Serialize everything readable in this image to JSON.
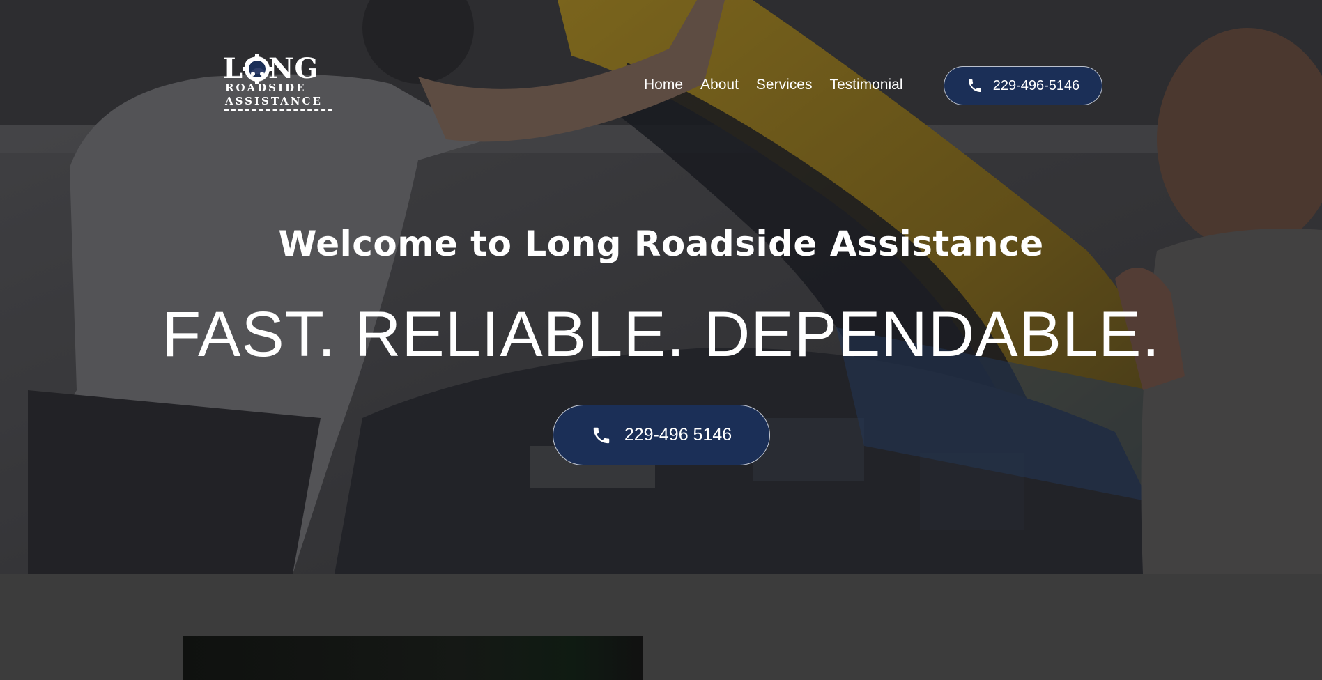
{
  "logo": {
    "word": "LONG",
    "line1": "ROADSIDE",
    "line2": "ASSISTANCE"
  },
  "nav": {
    "items": [
      {
        "label": "Home"
      },
      {
        "label": "About"
      },
      {
        "label": "Services"
      },
      {
        "label": "Testimonial"
      }
    ]
  },
  "header": {
    "phone_label": "229-496-5146"
  },
  "hero": {
    "welcome": "Welcome to Long Roadside Assistance",
    "tagline": "FAST. RELIABLE. DEPENDABLE.",
    "phone_label": "229-496 5146"
  },
  "colors": {
    "button_bg": "#1b2f57",
    "page_bg": "#3c3c3c",
    "car_yellow": "#c9a623"
  },
  "icons": [
    "phone-icon",
    "gear-icon"
  ]
}
